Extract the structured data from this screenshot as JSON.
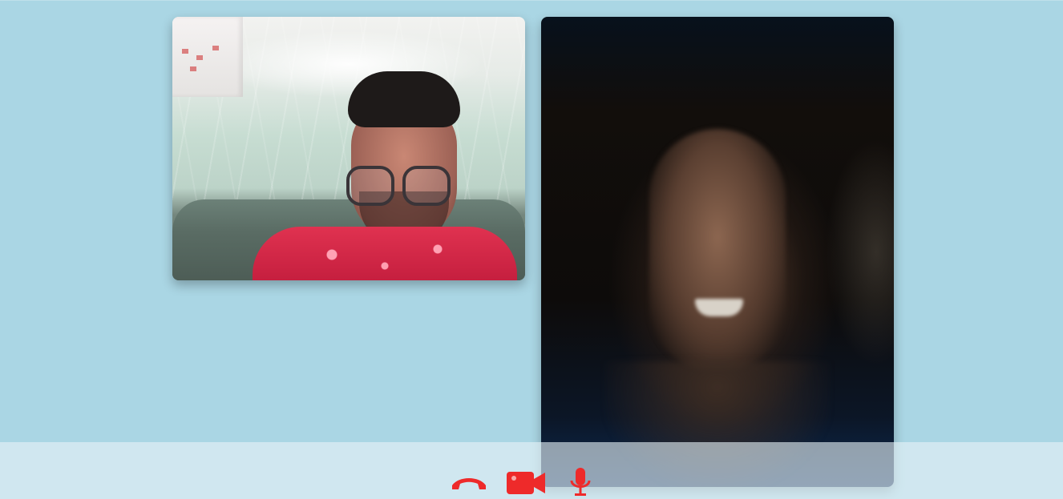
{
  "app": {
    "background_color": "#aad6e4",
    "control_bar_color": "#e6f2f7"
  },
  "videos": {
    "local": {
      "label": "",
      "feed": "local-camera-feed"
    },
    "remote": {
      "label": "",
      "feed": "remote-camera-feed"
    }
  },
  "controls": {
    "accent_color": "#ee2a2a",
    "hangup": {
      "icon": "phone-hangup-icon"
    },
    "camera": {
      "icon": "video-camera-icon"
    },
    "mic": {
      "icon": "microphone-icon"
    }
  }
}
